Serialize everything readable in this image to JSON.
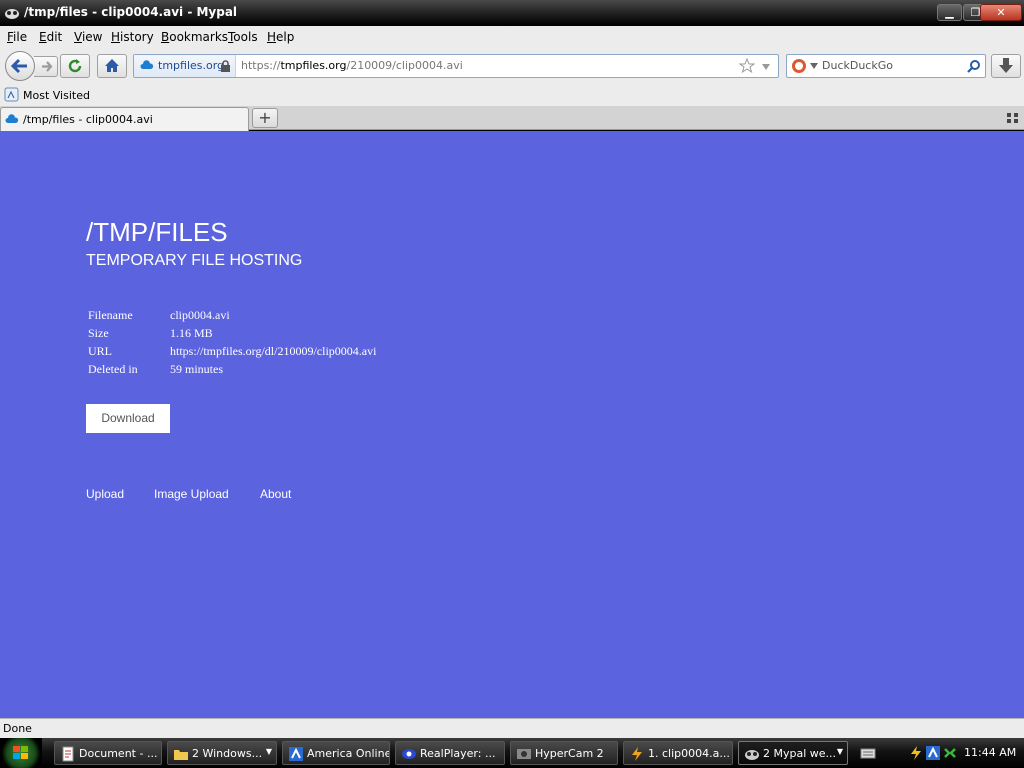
{
  "window": {
    "title": "/tmp/files - clip0004.avi - Mypal"
  },
  "menu": {
    "items": [
      {
        "label": "File",
        "ul": "F",
        "rest": "ile"
      },
      {
        "label": "Edit",
        "ul": "E",
        "rest": "dit"
      },
      {
        "label": "View",
        "ul": "V",
        "rest": "iew"
      },
      {
        "label": "History",
        "ul": "H",
        "rest": "istory"
      },
      {
        "label": "Bookmarks",
        "ul": "B",
        "rest": "ookmarks"
      },
      {
        "label": "Tools",
        "ul": "T",
        "rest": "ools"
      },
      {
        "label": "Help",
        "ul": "H",
        "rest": "elp"
      }
    ]
  },
  "navbar": {
    "identity_label": "tmpfiles.org",
    "url_scheme": "https://",
    "url_host": "tmpfiles.org",
    "url_path": "/210009/clip0004.avi",
    "search_placeholder": "DuckDuckGo"
  },
  "bookmarks": {
    "most_visited": "Most Visited"
  },
  "tabs": [
    {
      "label": "/tmp/files - clip0004.avi"
    }
  ],
  "page": {
    "title": "/TMP/FILES",
    "subtitle": "TEMPORARY FILE HOSTING",
    "info": [
      {
        "key": "Filename",
        "value": "clip0004.avi"
      },
      {
        "key": "Size",
        "value": "1.16 MB"
      },
      {
        "key": "URL",
        "value": "https://tmpfiles.org/dl/210009/clip0004.avi"
      },
      {
        "key": "Deleted in",
        "value": "59 minutes"
      }
    ],
    "download_label": "Download",
    "links": [
      "Upload",
      "Image Upload",
      "About"
    ],
    "background_color": "#5b63de"
  },
  "status": {
    "text": "Done"
  },
  "taskbar": {
    "tasks": [
      {
        "label": "Document - ...",
        "icon": "document-icon"
      },
      {
        "label": "2 Windows...",
        "icon": "folder-icon"
      },
      {
        "label": "America  Online",
        "icon": "aol-icon"
      },
      {
        "label": "RealPlayer: ...",
        "icon": "realplayer-icon"
      },
      {
        "label": "HyperCam 2",
        "icon": "hypercam-icon"
      },
      {
        "label": "1. clip0004.a...",
        "icon": "winamp-icon"
      },
      {
        "label": "2 Mypal we...",
        "icon": "mypal-icon"
      }
    ],
    "clock": "11:44 AM"
  }
}
